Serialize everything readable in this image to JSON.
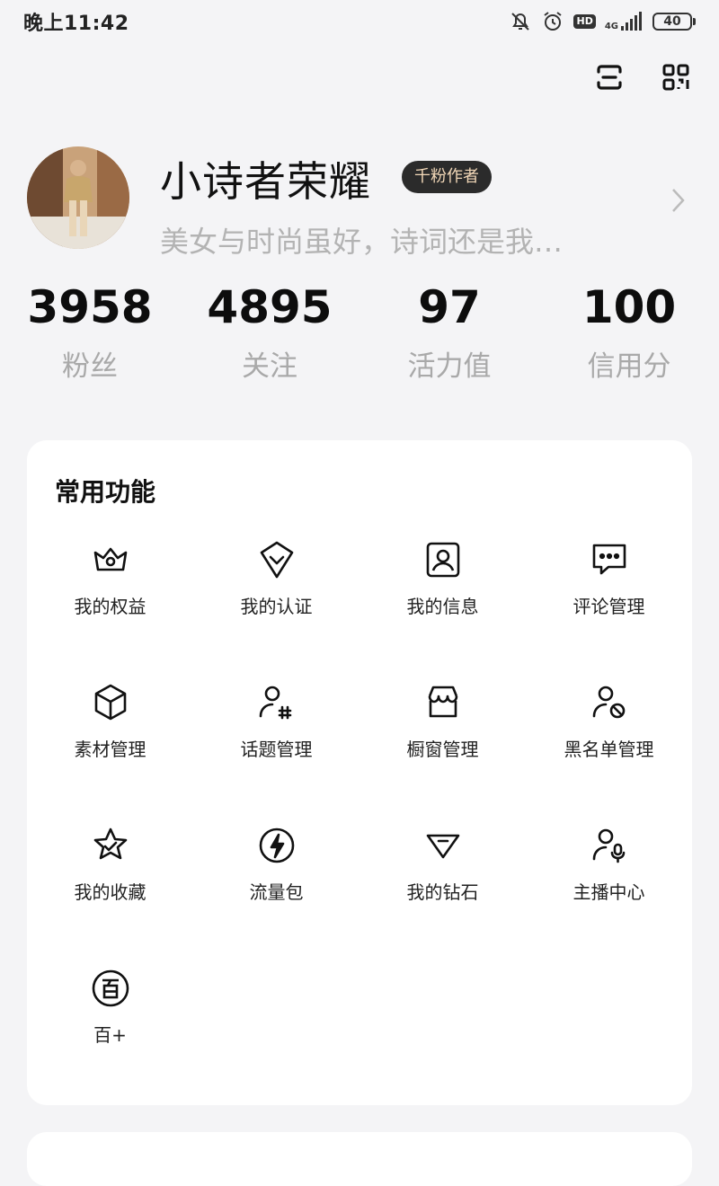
{
  "status": {
    "time": "晚上11:42",
    "hd": "HD",
    "network": "4G",
    "battery": "40"
  },
  "profile": {
    "name": "小诗者荣耀",
    "badge": "千粉作者",
    "bio": "美女与时尚虽好，诗词还是我…"
  },
  "stats": [
    {
      "value": "3958",
      "label": "粉丝"
    },
    {
      "value": "4895",
      "label": "关注"
    },
    {
      "value": "97",
      "label": "活力值"
    },
    {
      "value": "100",
      "label": "信用分"
    }
  ],
  "functions": {
    "title": "常用功能",
    "items": [
      {
        "label": "我的权益",
        "icon": "crown-icon"
      },
      {
        "label": "我的认证",
        "icon": "verify-icon"
      },
      {
        "label": "我的信息",
        "icon": "profile-card-icon"
      },
      {
        "label": "评论管理",
        "icon": "comment-icon"
      },
      {
        "label": "素材管理",
        "icon": "cube-icon"
      },
      {
        "label": "话题管理",
        "icon": "user-hashtag-icon"
      },
      {
        "label": "橱窗管理",
        "icon": "store-icon"
      },
      {
        "label": "黑名单管理",
        "icon": "user-block-icon"
      },
      {
        "label": "我的收藏",
        "icon": "star-check-icon"
      },
      {
        "label": "流量包",
        "icon": "lightning-icon"
      },
      {
        "label": "我的钻石",
        "icon": "diamond-icon"
      },
      {
        "label": "主播中心",
        "icon": "user-mic-icon"
      },
      {
        "label": "百+",
        "icon": "bai-plus-icon"
      }
    ]
  },
  "colors": {
    "background": "#f4f4f6",
    "card": "#ffffff",
    "badge_bg": "#2b2b2b",
    "badge_text": "#f3d8b8",
    "muted_text": "#a9a9a9"
  }
}
